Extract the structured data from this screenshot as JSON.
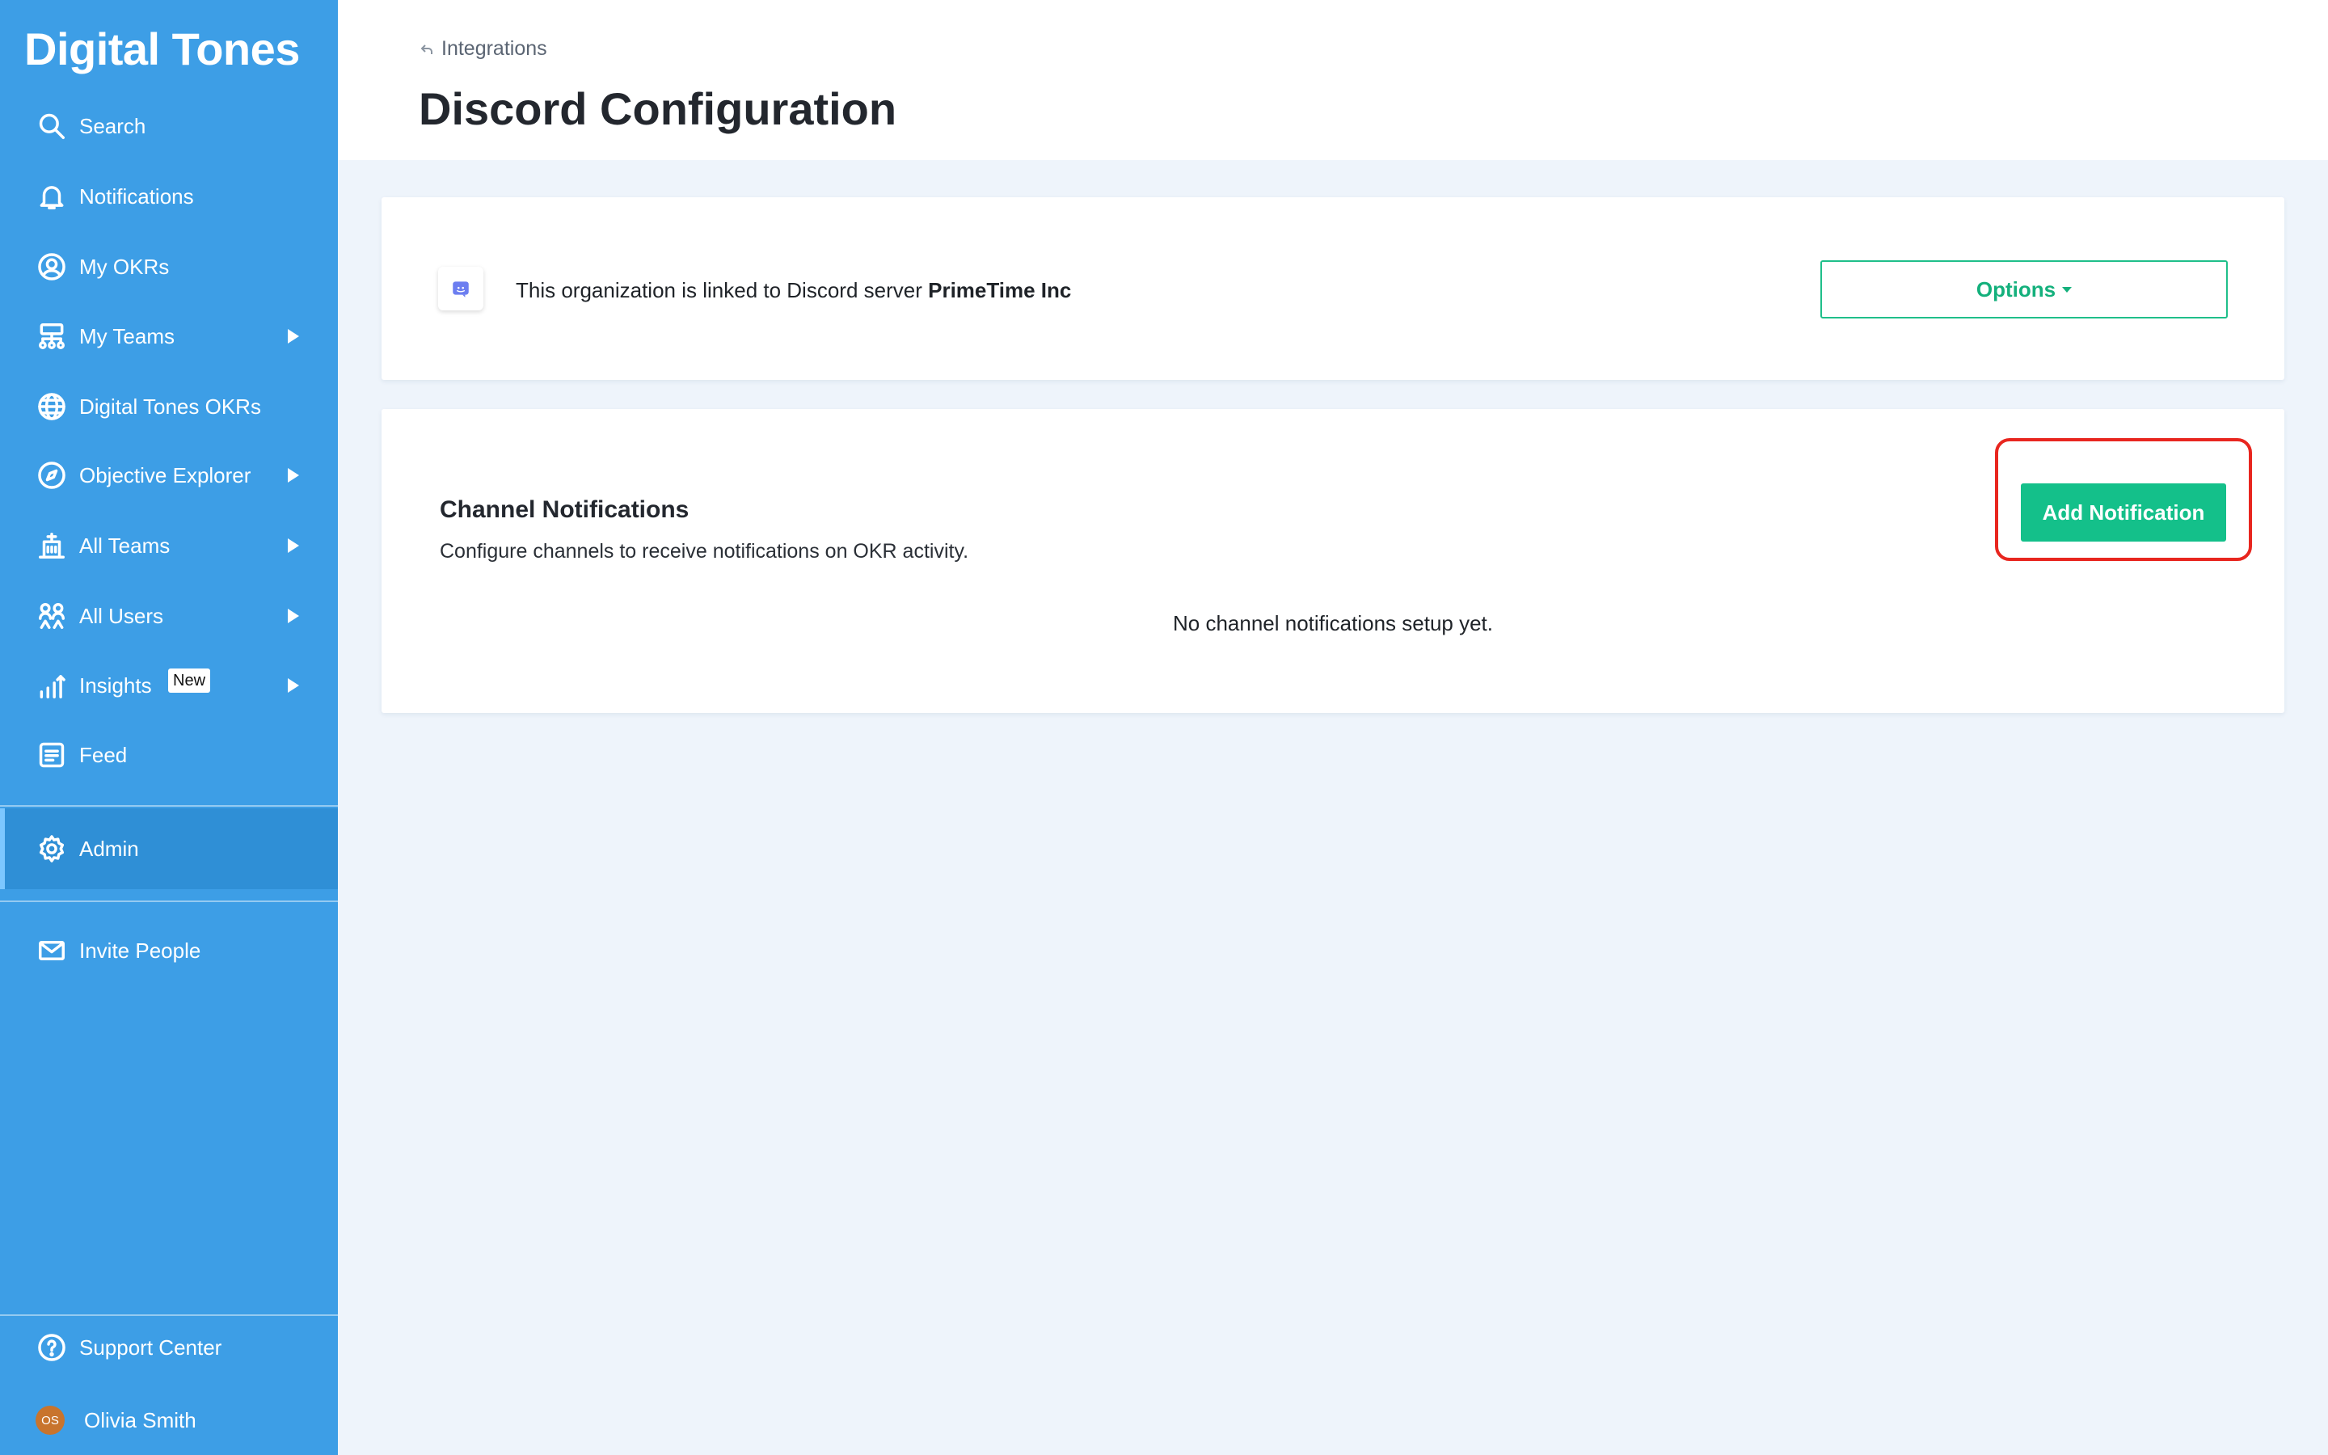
{
  "brand": "Digital Tones",
  "sidebar": {
    "items": [
      {
        "label": "Search"
      },
      {
        "label": "Notifications"
      },
      {
        "label": "My OKRs"
      },
      {
        "label": "My Teams"
      },
      {
        "label": "Digital Tones OKRs"
      },
      {
        "label": "Objective Explorer"
      },
      {
        "label": "All Teams"
      },
      {
        "label": "All Users"
      },
      {
        "label": "Insights",
        "badge": "New"
      },
      {
        "label": "Feed"
      },
      {
        "label": "Admin"
      },
      {
        "label": "Invite People"
      }
    ],
    "support": "Support Center",
    "user": {
      "name": "Olivia Smith",
      "initials": "OS"
    }
  },
  "header": {
    "breadcrumb": "Integrations",
    "title": "Discord Configuration"
  },
  "discord_card": {
    "text_prefix": "This organization is linked to Discord server ",
    "server_name": "PrimeTime Inc",
    "options_label": "Options"
  },
  "channel_card": {
    "title": "Channel Notifications",
    "description": "Configure channels to receive notifications on OKR activity.",
    "empty_text": "No channel notifications setup yet.",
    "add_label": "Add Notification"
  },
  "colors": {
    "sidebar": "#3d9ee6",
    "accent": "#14c08a",
    "highlight": "#e8261f"
  }
}
